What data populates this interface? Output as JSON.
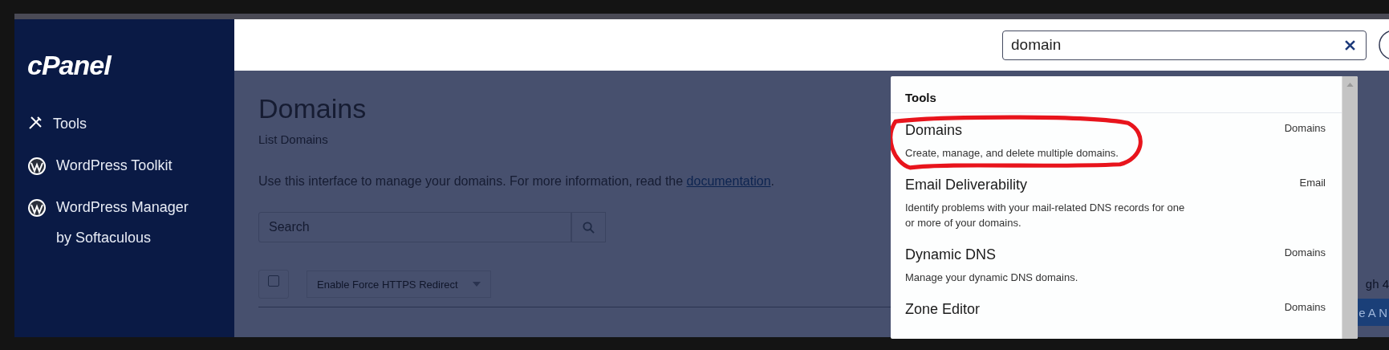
{
  "sidebar": {
    "logo": "cPanel",
    "items": [
      {
        "kind": "tools",
        "label": "Tools"
      },
      {
        "kind": "wordpress",
        "label": "WordPress Toolkit"
      },
      {
        "kind": "wordpress",
        "label": "WordPress Manager by Softaculous"
      }
    ]
  },
  "header": {
    "search": {
      "value": "domain"
    }
  },
  "page": {
    "title": "Domains",
    "subtitle": "List Domains",
    "intro": "Use this interface to manage your domains. For more information, read the ",
    "link": "documentation",
    "intro_end": ".",
    "search": {
      "placeholder": "Search"
    },
    "select_all": {
      "checked": false
    },
    "action": "Enable Force HTTPS Redirect",
    "right_text": "gh 4",
    "right_button": "e A N"
  },
  "results": {
    "heading": "Tools",
    "items": [
      {
        "title": "Domains",
        "description": "Create, manage, and delete multiple domains.",
        "category": "Domains",
        "highlighted": true
      },
      {
        "title": "Email Deliverability",
        "description": "Identify problems with your mail-related DNS records for one or more of your domains.",
        "category": "Email",
        "highlighted": false
      },
      {
        "title": "Dynamic DNS",
        "description": "Manage your dynamic DNS domains.",
        "category": "Domains",
        "highlighted": false
      },
      {
        "title": "Zone Editor",
        "category": "Domains",
        "highlighted": false
      }
    ]
  }
}
